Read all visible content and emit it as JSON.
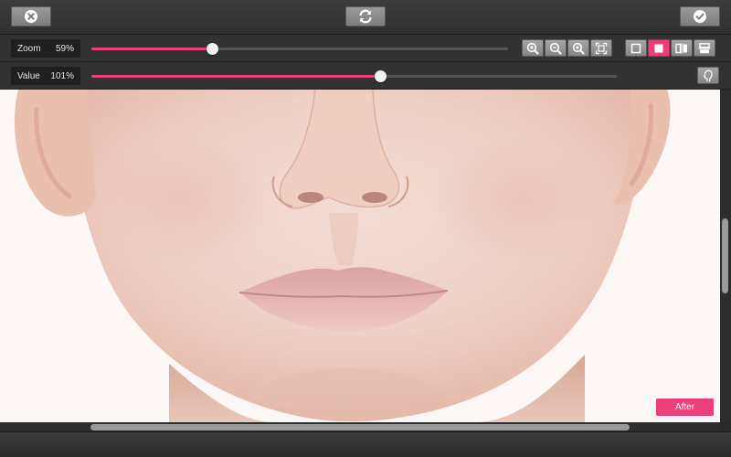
{
  "toolbar": {
    "cancel_icon": "close-circle-icon",
    "reset_icon": "refresh-icon",
    "apply_icon": "checkmark-circle-icon"
  },
  "zoom": {
    "label": "Zoom",
    "value_text": "59%",
    "value_fraction": 0.29
  },
  "zoom_tools": [
    {
      "name": "zoom-in-icon"
    },
    {
      "name": "zoom-out-icon"
    },
    {
      "name": "zoom-actual-icon"
    },
    {
      "name": "fit-to-screen-icon"
    }
  ],
  "view_modes": [
    {
      "name": "view-original-icon",
      "active": false
    },
    {
      "name": "view-result-icon",
      "active": true
    },
    {
      "name": "view-split-vertical-icon",
      "active": false
    },
    {
      "name": "view-split-horizontal-icon",
      "active": false
    }
  ],
  "value": {
    "label": "Value",
    "value_text": "101%",
    "value_fraction": 0.55,
    "tool_icon": "face-icon"
  },
  "canvas": {
    "badge": "After"
  },
  "colors": {
    "accent": "#ea3f7b",
    "toolbar": "#323232"
  },
  "scroll": {
    "vertical_fraction": 0.5,
    "horizontal_fraction": 0.5
  }
}
